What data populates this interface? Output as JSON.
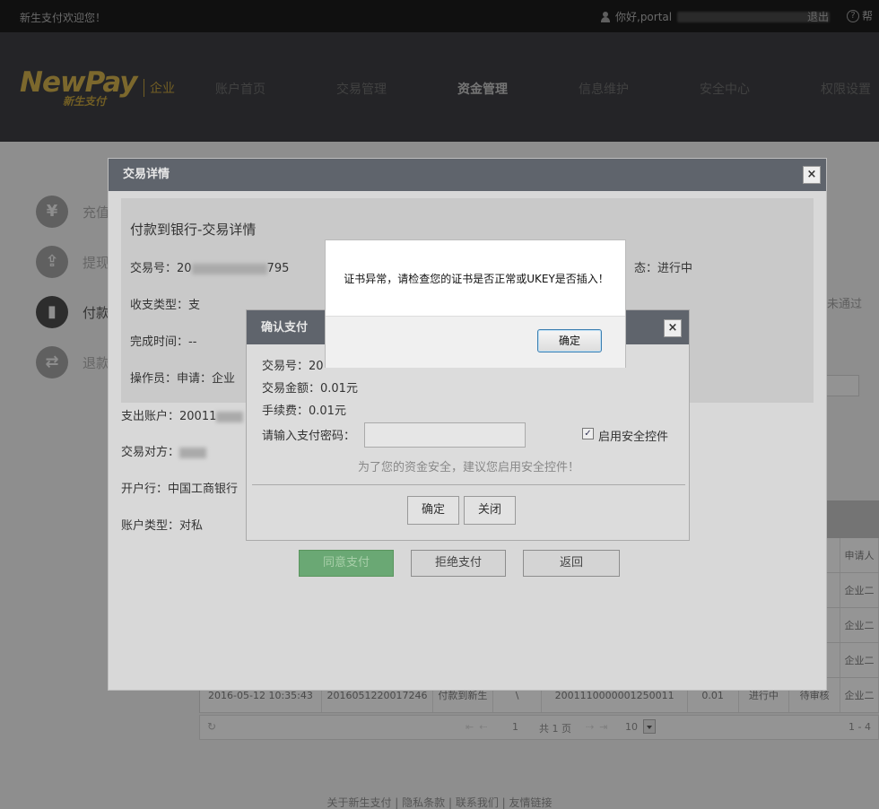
{
  "topbar": {
    "welcome": "新生支付欢迎您！",
    "greeting": "你好,portal",
    "logout": "退出",
    "help": "帮"
  },
  "logo": {
    "brand": "NewPay",
    "sub": "新生支付",
    "corp": "企业"
  },
  "nav": [
    {
      "label": "账户首页"
    },
    {
      "label": "交易管理"
    },
    {
      "label": "资金管理"
    },
    {
      "label": "信息维护"
    },
    {
      "label": "安全中心"
    },
    {
      "label": "权限设置"
    }
  ],
  "sidebar": [
    {
      "label": "充值",
      "glyph": "¥"
    },
    {
      "label": "提现",
      "glyph": "⇪"
    },
    {
      "label": "付款",
      "glyph": "▮"
    },
    {
      "label": "退款",
      "glyph": "⇄"
    }
  ],
  "background": {
    "status_not_passed": "未通过"
  },
  "table": {
    "header_applicant": "申请人",
    "rows": [
      {
        "applicant": "企业二"
      },
      {
        "applicant": "企业二"
      },
      {
        "applicant": "企业二"
      }
    ],
    "last_row": {
      "time": "2016-05-12 10:35:43",
      "trade_no": "2016051220017246",
      "type": "付款到新生",
      "dash": "\\",
      "account": "2001110000001250011",
      "amount": "0.01",
      "status": "进行中",
      "review": "待审核",
      "applicant": "企业二"
    }
  },
  "pager": {
    "page": "1",
    "total": "共 1 页",
    "size": "10",
    "range": "1 - 4"
  },
  "footer": {
    "links": "关于新生支付 | 隐私条款 | 联系我们 | 友情链接"
  },
  "detail_dialog": {
    "title": "交易详情",
    "close": "×",
    "heading": "付款到银行-交易详情",
    "trade_no_label": "交易号：20",
    "trade_no_tail": "795",
    "status": "态：进行中",
    "type": "收支类型：支",
    "finish_time": "完成时间：--",
    "operator": "操作员：申请：企业",
    "out_account": "支出账户：20011",
    "counterparty": "交易对方：",
    "bank": "开户行：中国工商银行",
    "account_type": "账户类型：对私",
    "agree": "同意支付",
    "reject": "拒绝支付",
    "back": "返回"
  },
  "confirm_dialog": {
    "title": "确认支付",
    "close": "×",
    "trade_no": "交易号：20",
    "amount": "交易金额：0.01元",
    "fee": "手续费：0.01元",
    "password_label": "请输入支付密码：",
    "password_value": "",
    "checkbox_checked": "✓",
    "enable_control": "启用安全控件",
    "tip": "为了您的资金安全，建议您启用安全控件！",
    "ok": "确定",
    "close_btn": "关闭"
  },
  "alert": {
    "message": "证书异常，请检查您的证书是否正常或UKEY是否插入！",
    "ok": "确定"
  }
}
